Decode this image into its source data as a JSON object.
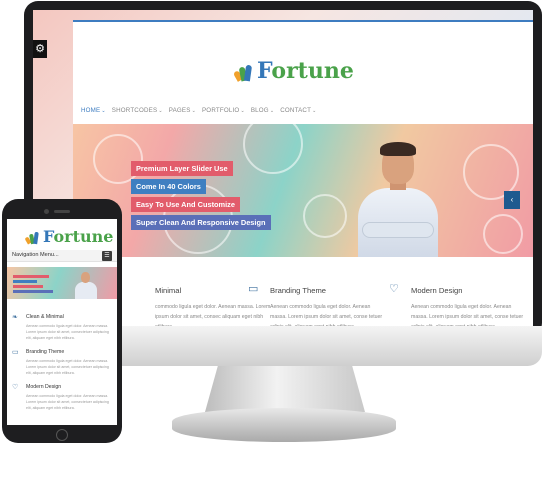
{
  "desktop": {
    "logo_text": "Fortune",
    "settings_icon": "gear-icon",
    "nav": [
      {
        "label": "HOME",
        "caret": "⌄"
      },
      {
        "label": "SHORTCODES",
        "caret": "⌄"
      },
      {
        "label": "PAGES",
        "caret": "⌄"
      },
      {
        "label": "PORTFOLIO",
        "caret": "⌄"
      },
      {
        "label": "BLOG",
        "caret": "⌄"
      },
      {
        "label": "CONTACT",
        "caret": "⌄"
      }
    ],
    "slider_tags": [
      {
        "text": "Premium Layer Slider Use",
        "color": "#e25c6b"
      },
      {
        "text": "Come In 40 Colors",
        "color": "#3f7fc1"
      },
      {
        "text": "Easy To Use And Customize",
        "color": "#e25c6b"
      },
      {
        "text": "Super Clean And Responsive Design",
        "color": "#5a6fb8"
      }
    ],
    "slider_arrow": "‹",
    "features": [
      {
        "title": "Minimal",
        "icon": "leaf-icon",
        "text": "commodo ligula eget dolor. Aenean massa. Lorem ipsum dolor sit amet, consec aliquam eget nibh etlibura."
      },
      {
        "title": "Branding Theme",
        "icon": "folder-icon",
        "text": "Aenean commodo ligula eget dolor. Aenean massa. Lorem ipsum dolor sit amet, conse tetuer adipis elit, aliquam eget nibh etlibura."
      },
      {
        "title": "Modern Design",
        "icon": "heart-icon",
        "text": "Aenean commodo ligula eget dolor. Aenean massa. Lorem ipsum dolor sit amet, conse tetuer adipis elit, aliquam eget nibh etlibura."
      }
    ]
  },
  "mobile": {
    "logo_text": "Fortune",
    "nav_label": "Navigation Menu...",
    "menu_icon": "menu-icon",
    "features": [
      {
        "title": "Clean & Minimal",
        "icon": "leaf-icon",
        "text": "Aenean commodo ligula eget dolor. Aenean massa. Lorem ipsum dolor sit amet, consectetuer adipiscing elit, aliquam eget nibh etlibura."
      },
      {
        "title": "Branding Theme",
        "icon": "folder-icon",
        "text": "Aenean commodo ligula eget dolor. Aenean massa. Lorem ipsum dolor sit amet, consectetuer adipiscing elit, aliquam eget nibh etlibura."
      },
      {
        "title": "Modern Design",
        "icon": "heart-icon",
        "text": "Aenean commodo ligula eget dolor. Aenean massa. Lorem ipsum dolor sit amet, consectetuer adipiscing elit, aliquam eget nibh etlibura."
      }
    ]
  },
  "colors": {
    "accent": "#3d7cc0",
    "logo_green": "#4aa24a",
    "logo_blue": "#3477b8"
  }
}
